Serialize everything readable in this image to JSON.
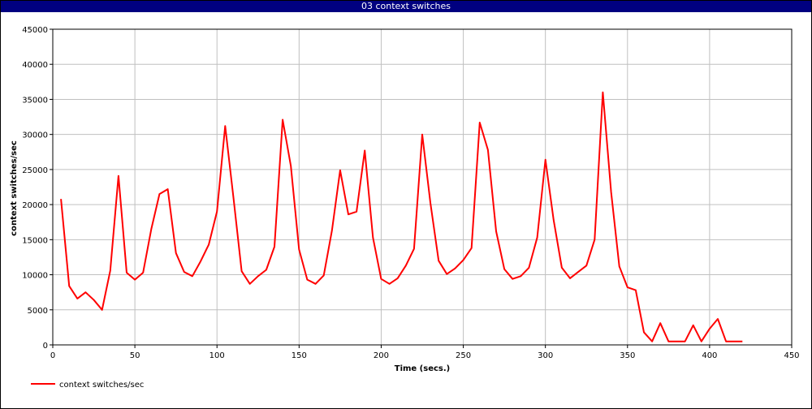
{
  "window": {
    "title": "03 context switches"
  },
  "chart_data": {
    "type": "line",
    "title": "03 context switches",
    "xlabel": "Time (secs.)",
    "ylabel": "context switches/sec",
    "xlim": [
      0,
      450
    ],
    "ylim": [
      0,
      45000
    ],
    "xticks": [
      0,
      50,
      100,
      150,
      200,
      250,
      300,
      350,
      400,
      450
    ],
    "yticks": [
      0,
      5000,
      10000,
      15000,
      20000,
      25000,
      30000,
      35000,
      40000,
      45000
    ],
    "grid": true,
    "legend_position": "bottom-left",
    "series": [
      {
        "name": "context switches/sec",
        "color": "#ff0000",
        "x": [
          5,
          10,
          15,
          20,
          25,
          30,
          35,
          40,
          45,
          50,
          55,
          60,
          65,
          70,
          75,
          80,
          85,
          90,
          95,
          100,
          105,
          110,
          115,
          120,
          125,
          130,
          135,
          140,
          145,
          150,
          155,
          160,
          165,
          170,
          175,
          180,
          185,
          190,
          195,
          200,
          205,
          210,
          215,
          220,
          225,
          230,
          235,
          240,
          245,
          250,
          255,
          260,
          265,
          270,
          275,
          280,
          285,
          290,
          295,
          300,
          305,
          310,
          315,
          320,
          325,
          330,
          335,
          340,
          345,
          350,
          355,
          360,
          365,
          370,
          375,
          380,
          385,
          390,
          395,
          400,
          405,
          410,
          415,
          420
        ],
        "y": [
          20800,
          8400,
          6600,
          7500,
          6400,
          5000,
          10600,
          24100,
          10300,
          9300,
          10300,
          16500,
          21500,
          22200,
          13100,
          10400,
          9800,
          11900,
          14300,
          19000,
          31200,
          21100,
          10500,
          8700,
          9800,
          10700,
          14000,
          32100,
          25500,
          13600,
          9300,
          8700,
          9900,
          16300,
          24900,
          18600,
          19000,
          27700,
          15300,
          9400,
          8700,
          9500,
          11300,
          13700,
          30000,
          20200,
          12000,
          10100,
          10900,
          12100,
          13800,
          31700,
          27800,
          16200,
          10800,
          9400,
          9800,
          11000,
          15300,
          26400,
          17800,
          11000,
          9500,
          10400,
          11300,
          15000,
          36000,
          21800,
          11200,
          8200,
          7800,
          1800,
          500,
          3100,
          500,
          500,
          500,
          2800,
          500,
          2300,
          3700,
          500,
          500,
          500
        ]
      }
    ]
  }
}
